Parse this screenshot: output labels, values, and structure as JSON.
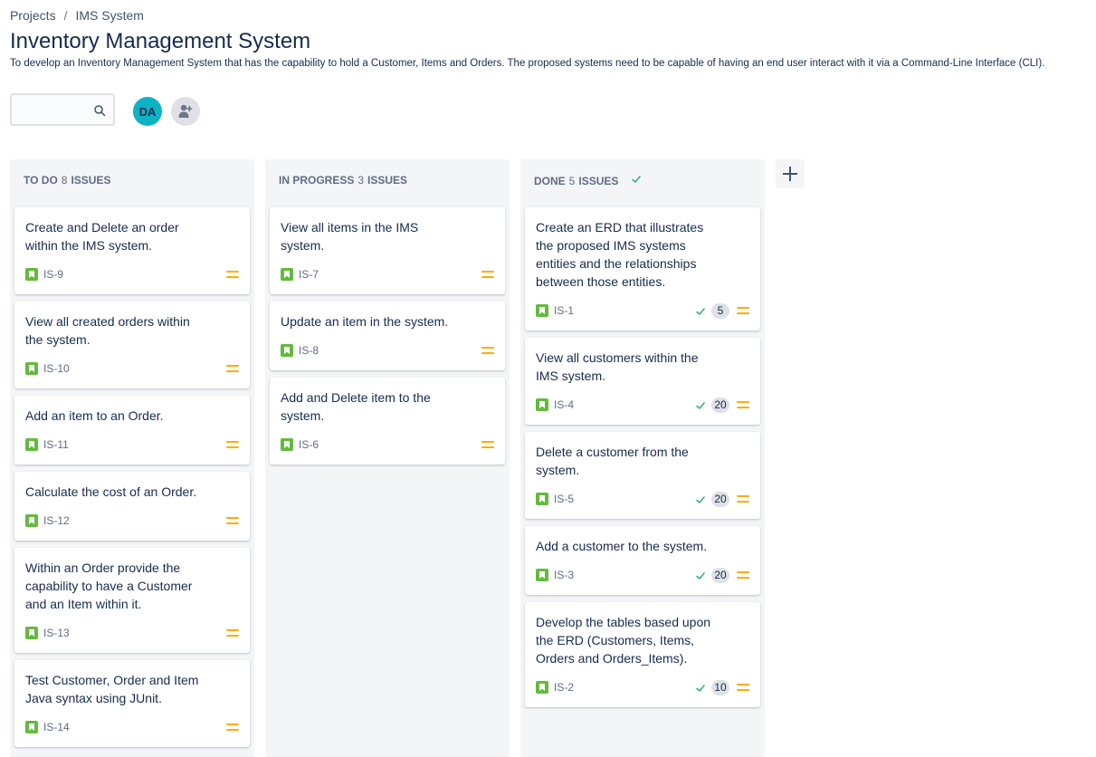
{
  "breadcrumb": {
    "projects": "Projects",
    "separator": "/",
    "project": "IMS System"
  },
  "page": {
    "title": "Inventory Management System",
    "description": "To develop an Inventory Management System that has the capability to hold a Customer, Items and Orders. The proposed systems need to be capable of having an end user interact with it via a Command-Line Interface (CLI)."
  },
  "search": {
    "placeholder": ""
  },
  "avatar": {
    "initials": "DA"
  },
  "colors": {
    "story": "#63ba3c",
    "priority_medium": "#ffab00",
    "done_check": "#36b37e",
    "avatar": "#0bb3c5"
  },
  "columns": [
    {
      "name": "TO DO",
      "count": "8",
      "suffix": "ISSUES",
      "cards": [
        {
          "summary": "Create and Delete an order within the IMS system.",
          "key": "IS-9"
        },
        {
          "summary": "View all created orders within the system.",
          "key": "IS-10"
        },
        {
          "summary": "Add an item to an Order.",
          "key": "IS-11"
        },
        {
          "summary": "Calculate the cost of an Order.",
          "key": "IS-12"
        },
        {
          "summary": "Within an Order provide the capability to have a Customer and an Item within it.",
          "key": "IS-13"
        },
        {
          "summary": "Test Customer, Order and Item Java syntax using JUnit.",
          "key": "IS-14"
        }
      ]
    },
    {
      "name": "IN PROGRESS",
      "count": "3",
      "suffix": "ISSUES",
      "cards": [
        {
          "summary": "View all items in the IMS system.",
          "key": "IS-7"
        },
        {
          "summary": "Update an item in the system.",
          "key": "IS-8"
        },
        {
          "summary": "Add and Delete item to the system.",
          "key": "IS-6"
        }
      ]
    },
    {
      "name": "DONE",
      "count": "5",
      "suffix": "ISSUES",
      "cards": [
        {
          "summary": "Create an ERD that illustrates the proposed IMS systems entities and the relationships between those entities.",
          "key": "IS-1",
          "estimate": "5"
        },
        {
          "summary": "View all customers within the IMS system.",
          "key": "IS-4",
          "estimate": "20"
        },
        {
          "summary": "Delete a customer from the system.",
          "key": "IS-5",
          "estimate": "20"
        },
        {
          "summary": "Add a customer to the system.",
          "key": "IS-3",
          "estimate": "20"
        },
        {
          "summary": "Develop the tables based upon the ERD (Customers, Items, Orders and Orders_Items).",
          "key": "IS-2",
          "estimate": "10"
        }
      ]
    }
  ]
}
